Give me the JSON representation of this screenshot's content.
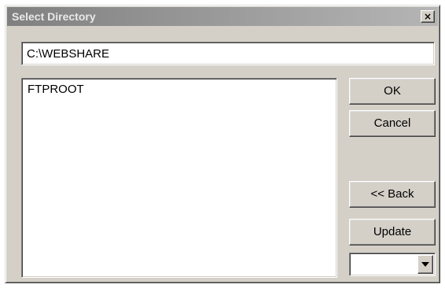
{
  "window": {
    "title": "Select Directory",
    "close_label": "×"
  },
  "path_field": {
    "value": "C:\\WEBSHARE"
  },
  "directory_list": {
    "items": [
      "FTPROOT"
    ]
  },
  "buttons": {
    "ok": "OK",
    "cancel": "Cancel",
    "back": "<< Back",
    "update": "Update"
  },
  "drive_select": {
    "selected": "",
    "icon": "chevron-down-icon"
  },
  "colors": {
    "dialog_face": "#d4d0c8",
    "titlebar_start": "#808080",
    "titlebar_end": "#b5b5b5",
    "field_background": "#ffffff"
  }
}
